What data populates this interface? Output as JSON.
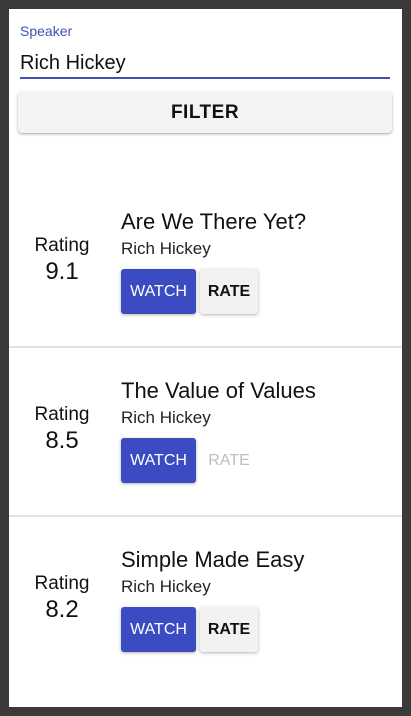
{
  "speaker_field": {
    "label": "Speaker",
    "value": "Rich Hickey"
  },
  "filter_button": "FILTER",
  "talks": [
    {
      "rating_label": "Rating",
      "rating": "9.1",
      "title": "Are We There Yet?",
      "speaker": "Rich Hickey",
      "watch_label": "WATCH",
      "rate_label": "RATE",
      "rate_enabled": true
    },
    {
      "rating_label": "Rating",
      "rating": "8.5",
      "title": "The Value of Values",
      "speaker": "Rich Hickey",
      "watch_label": "WATCH",
      "rate_label": "RATE",
      "rate_enabled": false
    },
    {
      "rating_label": "Rating",
      "rating": "8.2",
      "title": "Simple Made Easy",
      "speaker": "Rich Hickey",
      "watch_label": "WATCH",
      "rate_label": "RATE",
      "rate_enabled": true
    }
  ],
  "colors": {
    "accent": "#3f51b5",
    "watch_button": "#3b4cc2",
    "disabled_text": "#bdbdbd"
  }
}
